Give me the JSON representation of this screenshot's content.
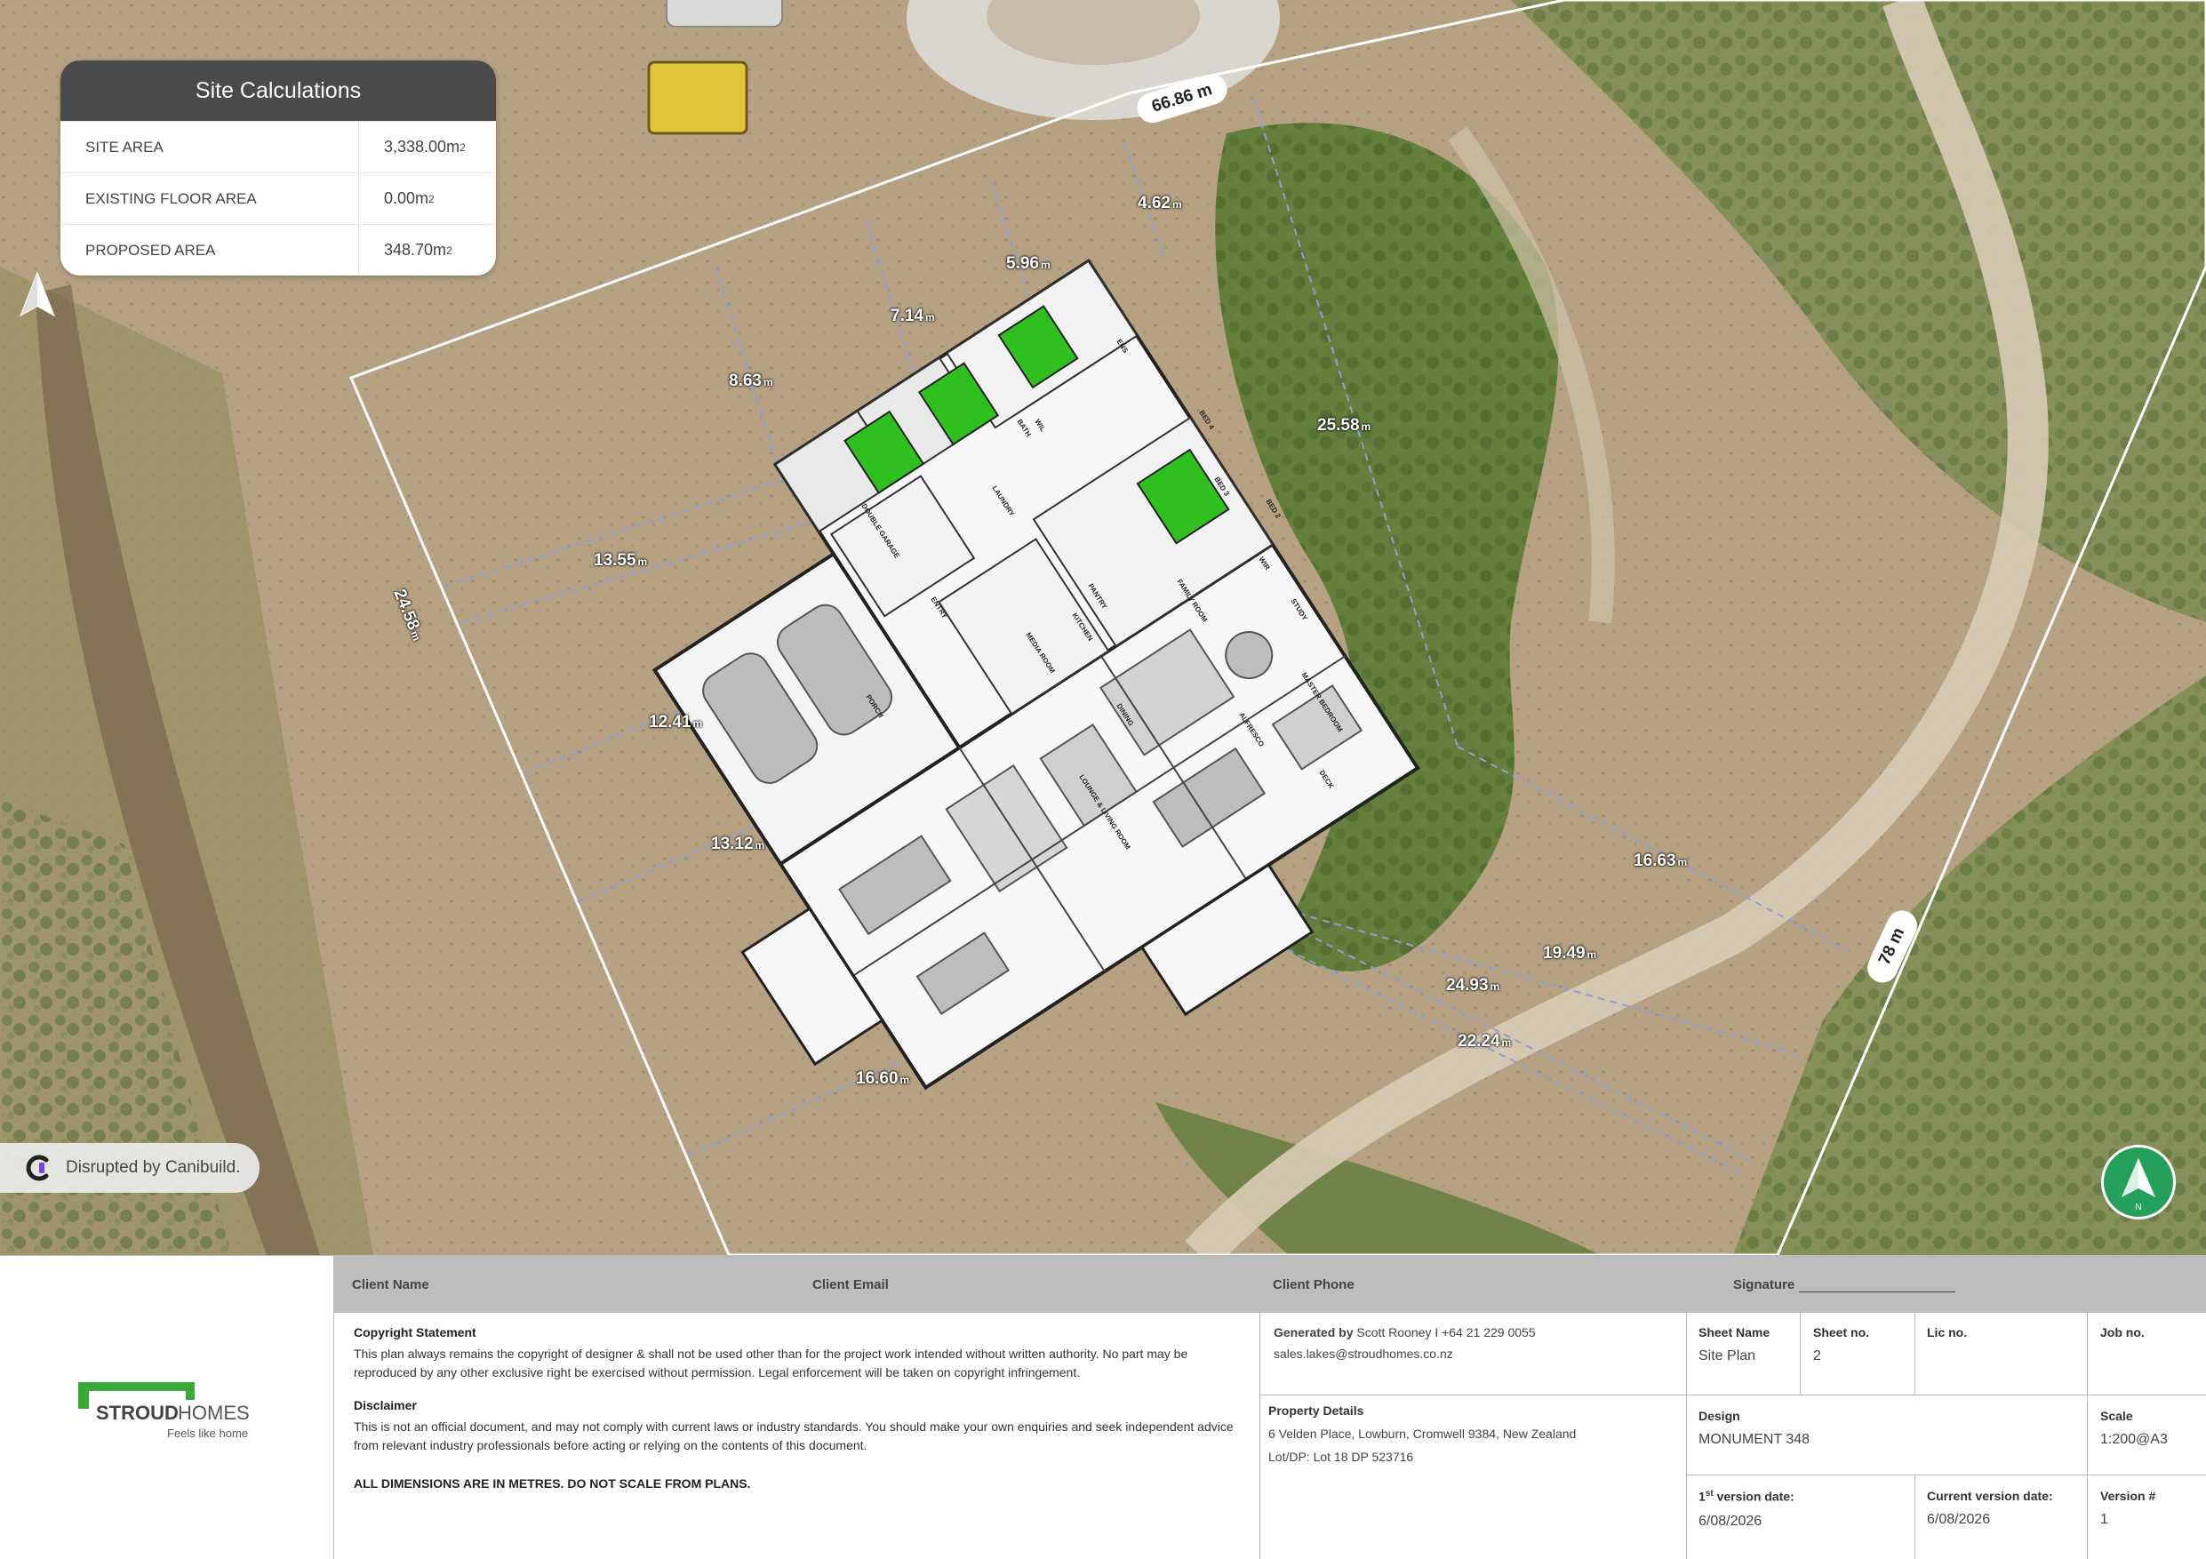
{
  "site_calculations": {
    "title": "Site Calculations",
    "rows": [
      {
        "label": "SITE AREA",
        "value": "3,338.00m",
        "unit_sup": "2"
      },
      {
        "label": "EXISTING FLOOR AREA",
        "value": "0.00m",
        "unit_sup": "2"
      },
      {
        "label": "PROPOSED AREA",
        "value": "348.70m",
        "unit_sup": "2"
      }
    ]
  },
  "map": {
    "boundary_labels": [
      "66.86 m",
      "78 m"
    ],
    "measurements": [
      "4.62",
      "5.96",
      "7.14",
      "8.63",
      "25.58",
      "13.55",
      "24.58",
      "12.41",
      "13.12",
      "16.60",
      "16.63",
      "19.49",
      "24.93",
      "22.24"
    ],
    "measurement_unit": "m",
    "rooms": [
      "DOUBLE GARAGE",
      "LAUNDRY",
      "BATH",
      "ENS",
      "BED 4",
      "BED 3",
      "BED 2",
      "STUDY",
      "ENTRY",
      "MEDIA ROOM",
      "KITCHEN",
      "DINING",
      "FAMILY ROOM",
      "ALFRESCO",
      "MASTER BEDROOM",
      "PORCH",
      "DECK",
      "PANTRY",
      "WIR",
      "WIL",
      "LOUNGE & LIVING ROOM"
    ],
    "north_label": "N",
    "badge_text": "Disrupted by Canibuild."
  },
  "colors": {
    "bedroom_green": "#2fbf1f",
    "north_badge": "#24a05a",
    "card_header": "#4a4a4a",
    "logo_green": "#3aa935"
  },
  "title_block": {
    "client_name_label": "Client Name",
    "client_email_label": "Client Email",
    "client_phone_label": "Client Phone",
    "signature_label": "Signature",
    "copyright_title": "Copyright Statement",
    "copyright_text": "This plan always remains the copyright of designer & shall not be used other than for the project work intended without written authority. No part may be reproduced by any other exclusive right be exercised without permission. Legal enforcement will be taken on copyright infringement.",
    "disclaimer_title": "Disclaimer",
    "disclaimer_text": "This is not an official document, and may not comply with current laws or industry standards. You should make your own enquiries and seek independent advice from relevant industry professionals before acting or relying on the contents of this document.",
    "dimensions_note": "ALL DIMENSIONS ARE IN METRES. DO NOT SCALE FROM PLANS.",
    "generated_by_label": "Generated by",
    "generated_by_value": "Scott Rooney I +64 21 229 0055",
    "generated_email": "sales.lakes@stroudhomes.co.nz",
    "property_details_label": "Property Details",
    "property_address": "6 Velden Place, Lowburn, Cromwell 9384, New Zealand",
    "property_lot": "Lot/DP: Lot 18 DP 523716",
    "sheet_name_label": "Sheet Name",
    "sheet_name_value": "Site Plan",
    "sheet_no_label": "Sheet no.",
    "sheet_no_value": "2",
    "lic_no_label": "Lic no.",
    "job_no_label": "Job no.",
    "design_label": "Design",
    "design_value": "MONUMENT 348",
    "scale_label": "Scale",
    "scale_value": "1:200@A3",
    "first_version_label_pre": "1",
    "first_version_label_sup": "st",
    "first_version_label_post": " version date:",
    "first_version_value": "6/08/2026",
    "current_version_label": "Current version date:",
    "current_version_value": "6/08/2026",
    "version_label": "Version #",
    "version_value": "1",
    "brand_name_1": "STROUD",
    "brand_name_2": "HOMES",
    "brand_tagline": "Feels like home"
  }
}
